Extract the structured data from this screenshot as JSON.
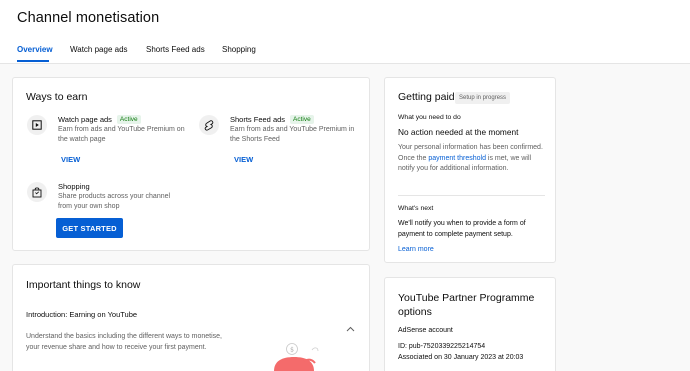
{
  "header": {
    "title": "Channel monetisation",
    "tabs": [
      {
        "label": "Overview",
        "active": true
      },
      {
        "label": "Watch page ads",
        "active": false
      },
      {
        "label": "Shorts Feed ads",
        "active": false
      },
      {
        "label": "Shopping",
        "active": false
      }
    ]
  },
  "ways_to_earn": {
    "title": "Ways to earn",
    "items": [
      {
        "name": "Watch page ads",
        "status": "Active",
        "description": "Earn from ads and YouTube Premium on the watch page",
        "action": "VIEW",
        "icon": "play-square-icon"
      },
      {
        "name": "Shorts Feed ads",
        "status": "Active",
        "description": "Earn from ads and YouTube Premium in the Shorts Feed",
        "action": "VIEW",
        "icon": "shorts-icon"
      },
      {
        "name": "Shopping",
        "status": "",
        "description": "Share products across your channel from your own shop",
        "action": "GET STARTED",
        "icon": "shopping-bag-icon"
      }
    ]
  },
  "important": {
    "title": "Important things to know",
    "section_title": "Introduction: Earning on YouTube",
    "section_body": "Understand the basics including the different ways to monetise, your revenue share and how to receive your first payment."
  },
  "getting_paid": {
    "title": "Getting paid",
    "status_chip": "Setup in progress",
    "todo_label": "What you need to do",
    "todo_value": "No action needed at the moment",
    "todo_body_before": "Your personal information has been confirmed. Once the",
    "todo_body_link": "payment threshold",
    "todo_body_after": "is met, we will notify you for additional information.",
    "next_label": "What's next",
    "next_body": "We'll notify you when to provide a form of payment to complete payment setup.",
    "learn_more": "Learn more"
  },
  "partner": {
    "title": "YouTube Partner Programme options",
    "adsense_label": "AdSense account",
    "id_line": "ID: pub-7520339225214754",
    "associated_line": "Associated on 30 January 2023 at 20:03"
  },
  "colors": {
    "accent": "#065fd4",
    "active_green": "#0e7a0d"
  }
}
